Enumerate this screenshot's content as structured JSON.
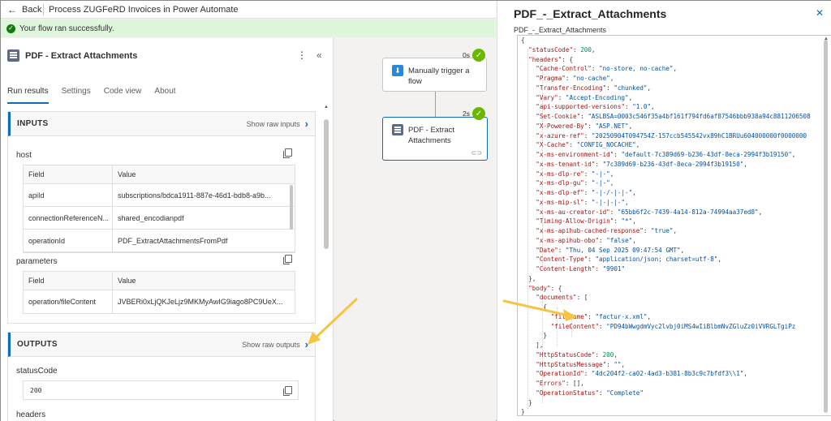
{
  "topbar": {
    "back_label": "Back",
    "flow_title": "Process ZUGFeRD Invoices in Power Automate"
  },
  "banner": {
    "text": "Your flow ran successfully."
  },
  "left_panel": {
    "action_title": "PDF - Extract Attachments",
    "tabs": [
      "Run results",
      "Settings",
      "Code view",
      "About"
    ],
    "inputs": {
      "title": "INPUTS",
      "show_raw": "Show raw inputs",
      "host_label": "host",
      "parameters_label": "parameters",
      "field_header": "Field",
      "value_header": "Value",
      "host_rows": [
        {
          "field": "apiId",
          "value": "subscriptions/bdca1911-887e-46d1-bdb8-a9b..."
        },
        {
          "field": "connectionReferenceN...",
          "value": "shared_encodianpdf"
        },
        {
          "field": "operationId",
          "value": "PDF_ExtractAttachmentsFromPdf"
        }
      ],
      "param_rows": [
        {
          "field": "operation/fileContent",
          "value": "JVBERi0xLjQKJeLjz9MKMyAwIG9iago8PC9UeX..."
        }
      ]
    },
    "outputs": {
      "title": "OUTPUTS",
      "show_raw": "Show raw outputs",
      "status_label": "statusCode",
      "status_value": "200",
      "headers_label": "headers"
    }
  },
  "canvas": {
    "trigger": {
      "label": "Manually trigger a flow",
      "duration": "0s"
    },
    "action": {
      "label": "PDF - Extract Attachments",
      "duration": "2s"
    }
  },
  "right_panel": {
    "title": "PDF_-_Extract_Attachments",
    "subtitle": "PDF_-_Extract_Attachments",
    "lines": [
      [
        [
          "p",
          "{"
        ]
      ],
      [
        [
          "p",
          "  "
        ],
        [
          "k",
          "\"statusCode\""
        ],
        [
          "p",
          ": "
        ],
        [
          "n",
          "200"
        ],
        [
          "p",
          ","
        ]
      ],
      [
        [
          "p",
          "  "
        ],
        [
          "k",
          "\"headers\""
        ],
        [
          "p",
          ": {"
        ]
      ],
      [
        [
          "p",
          "    "
        ],
        [
          "k",
          "\"Cache-Control\""
        ],
        [
          "p",
          ": "
        ],
        [
          "s",
          "\"no-store, no-cache\""
        ],
        [
          "p",
          ","
        ]
      ],
      [
        [
          "p",
          "    "
        ],
        [
          "k",
          "\"Pragma\""
        ],
        [
          "p",
          ": "
        ],
        [
          "s",
          "\"no-cache\""
        ],
        [
          "p",
          ","
        ]
      ],
      [
        [
          "p",
          "    "
        ],
        [
          "k",
          "\"Transfer-Encoding\""
        ],
        [
          "p",
          ": "
        ],
        [
          "s",
          "\"chunked\""
        ],
        [
          "p",
          ","
        ]
      ],
      [
        [
          "p",
          "    "
        ],
        [
          "k",
          "\"Vary\""
        ],
        [
          "p",
          ": "
        ],
        [
          "s",
          "\"Accept-Encoding\""
        ],
        [
          "p",
          ","
        ]
      ],
      [
        [
          "p",
          "    "
        ],
        [
          "k",
          "\"api-supported-versions\""
        ],
        [
          "p",
          ": "
        ],
        [
          "s",
          "\"1.0\""
        ],
        [
          "p",
          ","
        ]
      ],
      [
        [
          "p",
          "    "
        ],
        [
          "k",
          "\"Set-Cookie\""
        ],
        [
          "p",
          ": "
        ],
        [
          "s",
          "\"ASLBSA=0003c546f35a4bf161f794fd6af87546bbb938a94c8811206508"
        ]
      ],
      [
        [
          "p",
          "    "
        ],
        [
          "k",
          "\"X-Powered-By\""
        ],
        [
          "p",
          ": "
        ],
        [
          "s",
          "\"ASP.NET\""
        ],
        [
          "p",
          ","
        ]
      ],
      [
        [
          "p",
          "    "
        ],
        [
          "k",
          "\"x-azure-ref\""
        ],
        [
          "p",
          ": "
        ],
        [
          "s",
          "\"20250904T094754Z-157ccb545542vx89hC1BRUu604000000f0000000"
        ]
      ],
      [
        [
          "p",
          "    "
        ],
        [
          "k",
          "\"X-Cache\""
        ],
        [
          "p",
          ": "
        ],
        [
          "s",
          "\"CONFIG_NOCACHE\""
        ],
        [
          "p",
          ","
        ]
      ],
      [
        [
          "p",
          "    "
        ],
        [
          "k",
          "\"x-ms-environment-id\""
        ],
        [
          "p",
          ": "
        ],
        [
          "s",
          "\"default-7c389d69-b236-43df-8eca-2994f3b19150\""
        ],
        [
          "p",
          ","
        ]
      ],
      [
        [
          "p",
          "    "
        ],
        [
          "k",
          "\"x-ms-tenant-id\""
        ],
        [
          "p",
          ": "
        ],
        [
          "s",
          "\"7c389d69-b236-43df-8eca-2994f3b19150\""
        ],
        [
          "p",
          ","
        ]
      ],
      [
        [
          "p",
          "    "
        ],
        [
          "k",
          "\"x-ms-dlp-re\""
        ],
        [
          "p",
          ": "
        ],
        [
          "s",
          "\"-|-\""
        ],
        [
          "p",
          ","
        ]
      ],
      [
        [
          "p",
          "    "
        ],
        [
          "k",
          "\"x-ms-dlp-gu\""
        ],
        [
          "p",
          ": "
        ],
        [
          "s",
          "\"-|-\""
        ],
        [
          "p",
          ","
        ]
      ],
      [
        [
          "p",
          "    "
        ],
        [
          "k",
          "\"x-ms-dlp-ef\""
        ],
        [
          "p",
          ": "
        ],
        [
          "s",
          "\"-|-/-|-|-\""
        ],
        [
          "p",
          ","
        ]
      ],
      [
        [
          "p",
          "    "
        ],
        [
          "k",
          "\"x-ms-mip-sl\""
        ],
        [
          "p",
          ": "
        ],
        [
          "s",
          "\"-|-|-|-\""
        ],
        [
          "p",
          ","
        ]
      ],
      [
        [
          "p",
          "    "
        ],
        [
          "k",
          "\"x-ms-au-creator-id\""
        ],
        [
          "p",
          ": "
        ],
        [
          "s",
          "\"65bb6f2c-7439-4a14-812a-74994aa37ed8\""
        ],
        [
          "p",
          ","
        ]
      ],
      [
        [
          "p",
          "    "
        ],
        [
          "k",
          "\"Timing-Allow-Origin\""
        ],
        [
          "p",
          ": "
        ],
        [
          "s",
          "\"*\""
        ],
        [
          "p",
          ","
        ]
      ],
      [
        [
          "p",
          "    "
        ],
        [
          "k",
          "\"x-ms-apihub-cached-response\""
        ],
        [
          "p",
          ": "
        ],
        [
          "s",
          "\"true\""
        ],
        [
          "p",
          ","
        ]
      ],
      [
        [
          "p",
          "    "
        ],
        [
          "k",
          "\"x-ms-apihub-obo\""
        ],
        [
          "p",
          ": "
        ],
        [
          "s",
          "\"false\""
        ],
        [
          "p",
          ","
        ]
      ],
      [
        [
          "p",
          "    "
        ],
        [
          "k",
          "\"Date\""
        ],
        [
          "p",
          ": "
        ],
        [
          "s",
          "\"Thu, 04 Sep 2025 09:47:54 GMT\""
        ],
        [
          "p",
          ","
        ]
      ],
      [
        [
          "p",
          "    "
        ],
        [
          "k",
          "\"Content-Type\""
        ],
        [
          "p",
          ": "
        ],
        [
          "s",
          "\"application/json; charset=utf-8\""
        ],
        [
          "p",
          ","
        ]
      ],
      [
        [
          "p",
          "    "
        ],
        [
          "k",
          "\"Content-Length\""
        ],
        [
          "p",
          ": "
        ],
        [
          "s",
          "\"9901\""
        ]
      ],
      [
        [
          "p",
          "  },"
        ]
      ],
      [
        [
          "p",
          "  "
        ],
        [
          "k",
          "\"body\""
        ],
        [
          "p",
          ": {"
        ]
      ],
      [
        [
          "p",
          "    "
        ],
        [
          "k",
          "\"documents\""
        ],
        [
          "p",
          ": ["
        ]
      ],
      [
        [
          "p",
          "      {"
        ]
      ],
      [
        [
          "p",
          "        "
        ],
        [
          "k",
          "\"fileName\""
        ],
        [
          "p",
          ": "
        ],
        [
          "s",
          "\"factur-x.xml\""
        ],
        [
          "p",
          ","
        ]
      ],
      [
        [
          "p",
          "        "
        ],
        [
          "k",
          "\"fileContent\""
        ],
        [
          "p",
          ": "
        ],
        [
          "s",
          "\"PD94bWwgdmVyc2lvbj0iMS4wIiBlbmNvZGluZz0iVVRGLTgiPz"
        ]
      ],
      [
        [
          "p",
          "      }"
        ]
      ],
      [
        [
          "p",
          "    ],"
        ]
      ],
      [
        [
          "p",
          "    "
        ],
        [
          "k",
          "\"HttpStatusCode\""
        ],
        [
          "p",
          ": "
        ],
        [
          "n",
          "200"
        ],
        [
          "p",
          ","
        ]
      ],
      [
        [
          "p",
          "    "
        ],
        [
          "k",
          "\"HttpStatusMessage\""
        ],
        [
          "p",
          ": "
        ],
        [
          "s",
          "\"\""
        ],
        [
          "p",
          ","
        ]
      ],
      [
        [
          "p",
          "    "
        ],
        [
          "k",
          "\"OperationId\""
        ],
        [
          "p",
          ": "
        ],
        [
          "s",
          "\"4dc204f2-ca02-4ad3-b381-8b3c9c7bfdf3\\\\1\""
        ],
        [
          "p",
          ","
        ]
      ],
      [
        [
          "p",
          "    "
        ],
        [
          "k",
          "\"Errors\""
        ],
        [
          "p",
          ": [],"
        ]
      ],
      [
        [
          "p",
          "    "
        ],
        [
          "k",
          "\"OperationStatus\""
        ],
        [
          "p",
          ": "
        ],
        [
          "s",
          "\"Complete\""
        ]
      ],
      [
        [
          "p",
          "  }"
        ]
      ],
      [
        [
          "p",
          "}"
        ]
      ]
    ]
  },
  "colors": {
    "accent": "#0f6cbd",
    "success": "#107c10",
    "arrow": "#f5c542"
  }
}
